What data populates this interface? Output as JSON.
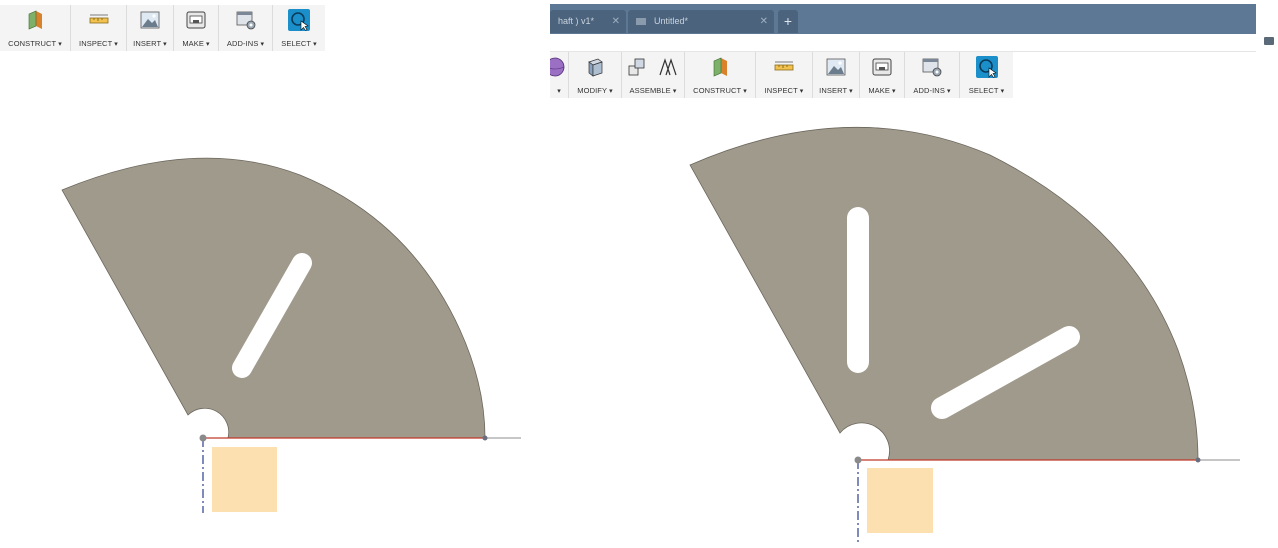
{
  "left": {
    "toolbar_groups": [
      {
        "label": "CONSTRUCT",
        "icon": "construct-plane-icon"
      },
      {
        "label": "INSPECT",
        "icon": "measure-icon"
      },
      {
        "label": "INSERT",
        "icon": "insert-image-icon"
      },
      {
        "label": "MAKE",
        "icon": "3d-print-icon"
      },
      {
        "label": "ADD-INS",
        "icon": "scripts-addins-icon"
      },
      {
        "label": "SELECT",
        "icon": "select-cursor-icon"
      }
    ]
  },
  "right": {
    "tabs": [
      {
        "label": "haft ) v1*",
        "close": "✕"
      },
      {
        "label": "Untitled*",
        "close": "✕"
      }
    ],
    "new_tab_label": "+",
    "toolbar_groups": [
      {
        "label": "",
        "icon": "sphere-icon"
      },
      {
        "label": "MODIFY",
        "icon": "press-pull-icon"
      },
      {
        "label": "ASSEMBLE",
        "icon": "joint-icon"
      },
      {
        "label": "CONSTRUCT",
        "icon": "construct-plane-icon"
      },
      {
        "label": "INSPECT",
        "icon": "measure-icon"
      },
      {
        "label": "INSERT",
        "icon": "insert-image-icon"
      },
      {
        "label": "MAKE",
        "icon": "3d-print-icon"
      },
      {
        "label": "ADD-INS",
        "icon": "scripts-addins-icon"
      },
      {
        "label": "SELECT",
        "icon": "select-cursor-icon"
      }
    ]
  },
  "colors": {
    "part_fill": "#a09a8c",
    "origin_box": "#fde0b0",
    "tab_bar": "#5d7894",
    "select_accent": "#1a8fc9",
    "axis_red": "#c0392b",
    "axis_blue": "#2c3e8f"
  }
}
